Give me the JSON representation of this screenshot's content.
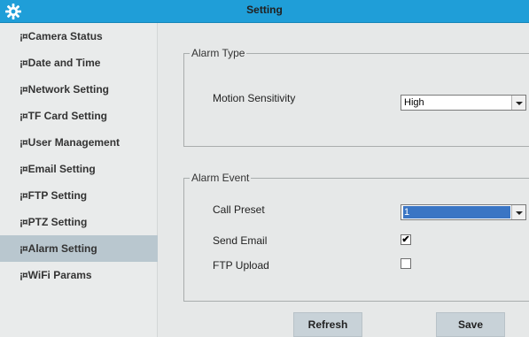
{
  "window": {
    "title": "Setting"
  },
  "icons": {
    "logo": "gear-icon",
    "checked": "checkmark-icon"
  },
  "colors": {
    "titlebar": "#1f9ed8",
    "active_nav": "#b9c7cf",
    "selection": "#3a75c4"
  },
  "sidebar": {
    "bullet": "¡¤",
    "items": [
      {
        "label": "Camera Status"
      },
      {
        "label": "Date and Time"
      },
      {
        "label": "Network Setting"
      },
      {
        "label": "TF Card Setting"
      },
      {
        "label": "User Management"
      },
      {
        "label": "Email Setting"
      },
      {
        "label": "FTP Setting"
      },
      {
        "label": "PTZ Setting"
      },
      {
        "label": "Alarm Setting",
        "active": true
      },
      {
        "label": "WiFi Params"
      }
    ]
  },
  "alarm_type": {
    "legend": "Alarm Type",
    "motion_sensitivity": {
      "label": "Motion Sensitivity",
      "value": "High"
    }
  },
  "alarm_event": {
    "legend": "Alarm Event",
    "call_preset": {
      "label": "Call Preset",
      "value": "1"
    },
    "send_email": {
      "label": "Send Email",
      "checked": true
    },
    "ftp_upload": {
      "label": "FTP Upload",
      "checked": false
    }
  },
  "buttons": {
    "refresh": "Refresh",
    "save": "Save"
  }
}
